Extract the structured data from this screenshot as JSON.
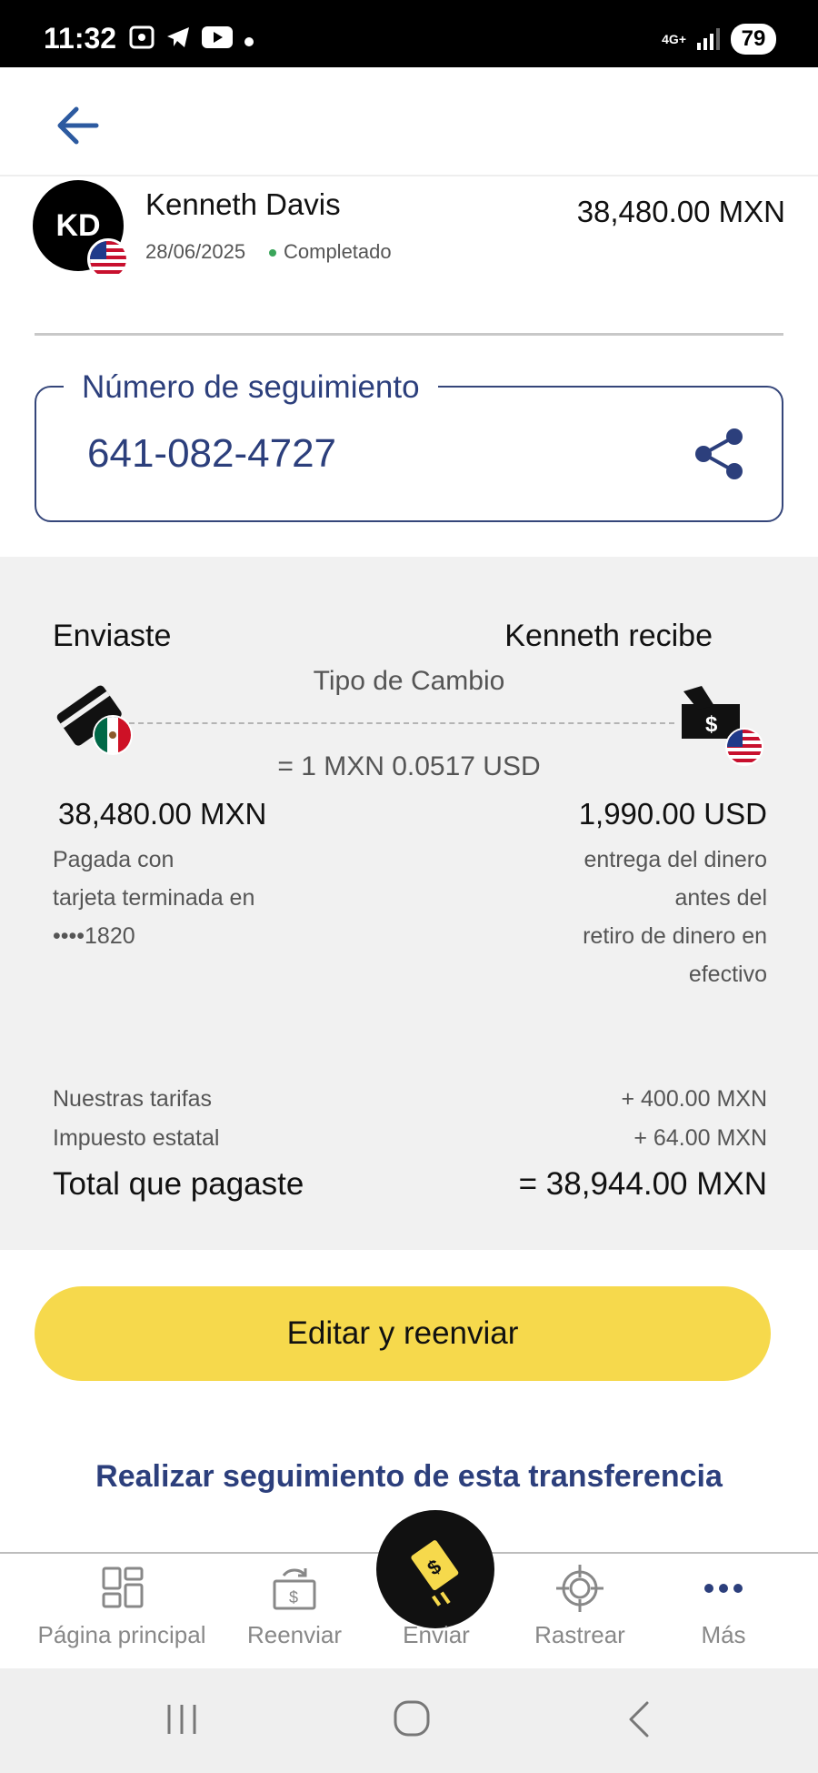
{
  "status_bar": {
    "time": "11:32",
    "network": "4G+",
    "battery": "79"
  },
  "transfer": {
    "avatar_initials": "KD",
    "recipient_name": "Kenneth Davis",
    "date": "28/06/2025",
    "status": "Completado",
    "amount": "38,480.00 MXN"
  },
  "tracking": {
    "label": "Número de seguimiento",
    "number": "641-082-4727"
  },
  "summary": {
    "sent_title": "Enviaste",
    "receive_title": "Kenneth recibe",
    "rate_label": "Tipo de Cambio",
    "rate_value": "= 1 MXN 0.0517 USD",
    "sent_amount": "38,480.00 MXN",
    "received_amount": "1,990.00 USD",
    "paid_with_line1": "Pagada con",
    "paid_with_line2": "tarjeta terminada en",
    "paid_with_line3": "••••1820",
    "delivery_line1": "entrega del dinero",
    "delivery_line2": "antes del",
    "delivery_line3": "retiro de dinero en",
    "delivery_line4": "efectivo",
    "fees_label": "Nuestras tarifas",
    "fees_value": "+ 400.00 MXN",
    "tax_label": "Impuesto estatal",
    "tax_value": "+ 64.00 MXN",
    "total_label": "Total que pagaste",
    "total_value": "= 38,944.00 MXN"
  },
  "actions": {
    "edit_resend": "Editar y reenviar",
    "track_transfer": "Realizar seguimiento de esta transferencia"
  },
  "nav": {
    "home": "Página principal",
    "resend": "Reenviar",
    "send": "Enviar",
    "track": "Rastrear",
    "more": "Más"
  },
  "colors": {
    "brand_blue": "#2c3f7c",
    "accent_yellow": "#f6d94c",
    "success_green": "#3aa55a"
  }
}
